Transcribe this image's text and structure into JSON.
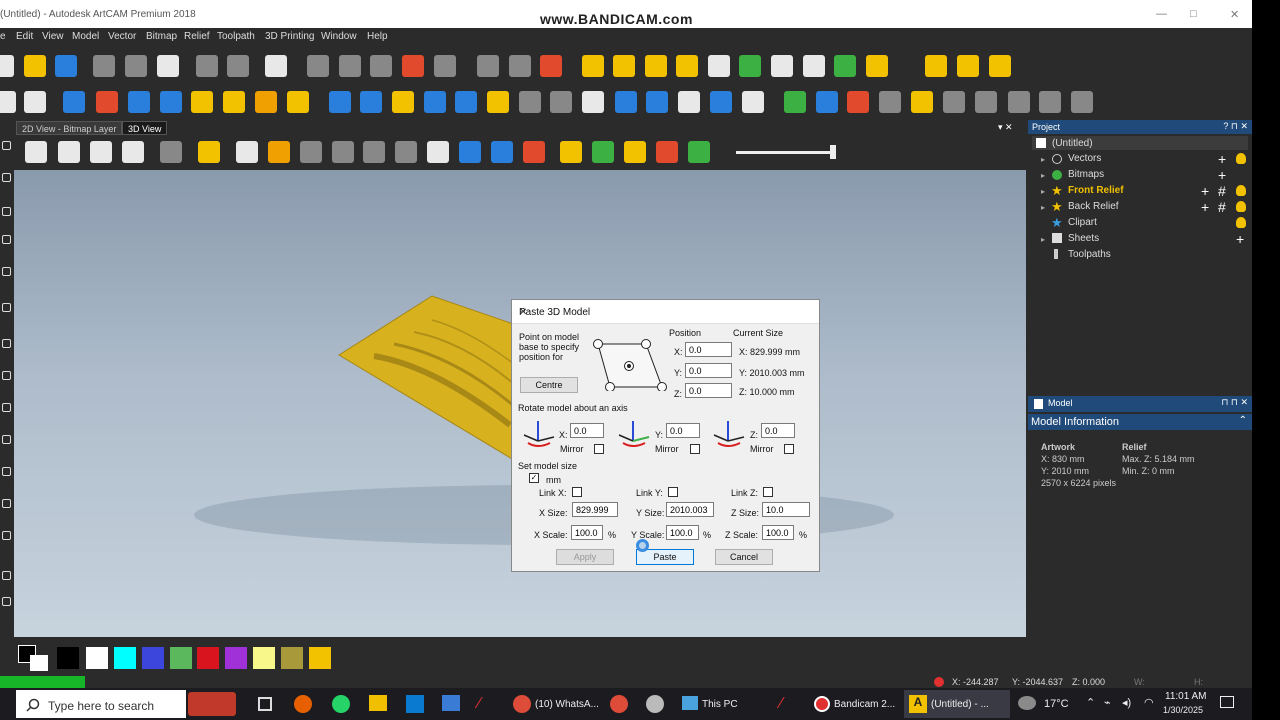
{
  "window": {
    "title": "(Untitled) - Autodesk ArtCAM Premium 2018",
    "watermark": "www.BANDICAM.com",
    "min_label": "—",
    "max_label": "□",
    "close_label": "✕"
  },
  "menu": [
    "e",
    "Edit",
    "View",
    "Model",
    "Vector",
    "Bitmap",
    "Relief",
    "Toolpath",
    "3D Printing",
    "Window",
    "Help"
  ],
  "view_tabs": [
    "2D View - Bitmap Layer",
    "3D View"
  ],
  "project_panel": {
    "header": "Project",
    "controls": "? ⊓ ✕",
    "items": [
      {
        "label": "(Untitled)"
      },
      {
        "label": "Vectors"
      },
      {
        "label": "Bitmaps"
      },
      {
        "label": "Front Relief"
      },
      {
        "label": "Back Relief"
      },
      {
        "label": "Clipart"
      },
      {
        "label": "Sheets"
      },
      {
        "label": "Toolpaths"
      }
    ]
  },
  "model_panel": {
    "header": "Model",
    "controls": "⊓ ⊓ ✕",
    "section_title": "Model Information",
    "artwork": {
      "heading": "Artwork",
      "x": "X: 830 mm",
      "y": "Y: 2010 mm",
      "pixels": "2570 x 6224 pixels"
    },
    "relief": {
      "heading": "Relief",
      "max_z": "Max. Z: 5.184 mm",
      "min_z": "Min. Z: 0 mm"
    }
  },
  "dialog": {
    "title": "Paste 3D Model",
    "close": "✕",
    "point_text": [
      "Point on model",
      "base to specify",
      "position for"
    ],
    "centre_button": "Centre",
    "position_header": "Position",
    "current_size_header": "Current Size",
    "pos_x_label": "X:",
    "pos_x": "0.0",
    "pos_y_label": "Y:",
    "pos_y": "0.0",
    "pos_z_label": "Z:",
    "pos_z": "0.0",
    "cur_x": "X:  829.999 mm",
    "cur_y": "Y:  2010.003 mm",
    "cur_z": "Z:  10.000 mm",
    "rotate_title": "Rotate model about an axis",
    "rot_x_label": "X:",
    "rot_x": "0.0",
    "rot_y_label": "Y:",
    "rot_y": "0.0",
    "rot_z_label": "Z:",
    "rot_z": "0.0",
    "mirror_label": "Mirror",
    "size_title": "Set model size",
    "mm_label": "mm",
    "link_x": "Link X:",
    "link_y": "Link Y:",
    "link_z": "Link Z:",
    "x_size_label": "X Size:",
    "x_size": "829.999",
    "y_size_label": "Y Size:",
    "y_size": "2010.003",
    "z_size_label": "Z Size:",
    "z_size": "10.0",
    "x_scale_label": "X Scale:",
    "x_scale": "100.0",
    "y_scale_label": "Y Scale:",
    "y_scale": "100.0",
    "z_scale_label": "Z Scale:",
    "z_scale": "100.0",
    "percent": "%",
    "apply_button": "Apply",
    "paste_button": "Paste",
    "cancel_button": "Cancel"
  },
  "status": {
    "x": "X: -244.287",
    "y": "Y: -2044.637",
    "z": "Z: 0.000",
    "w": "W:",
    "h": "H:"
  },
  "palette_colors": [
    "#000000",
    "#ffffff",
    "#00ffff",
    "#3c46dc",
    "#5cb85c",
    "#d8141e",
    "#a030d8",
    "#f8f88a",
    "#a89a3a",
    "#f2c200"
  ],
  "taskbar": {
    "search_placeholder": "Type here to search",
    "apps": [
      "(10) WhatsA...",
      "This PC",
      "Bandicam 2...",
      "(Untitled) - ..."
    ],
    "weather": "17°C",
    "time": "11:01 AM",
    "date": "1/30/2025"
  }
}
